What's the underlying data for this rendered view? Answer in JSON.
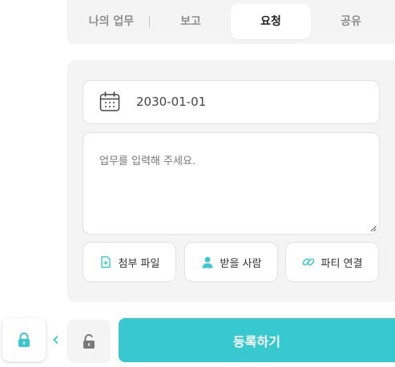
{
  "tabs": [
    {
      "label": "나의 업무",
      "active": false
    },
    {
      "label": "보고",
      "active": false
    },
    {
      "label": "요청",
      "active": true
    },
    {
      "label": "공유",
      "active": false
    }
  ],
  "form": {
    "date": "2030-01-01",
    "task_placeholder": "업무를 입력해 주세요.",
    "attach_label": "첨부 파일",
    "recipient_label": "받을 사람",
    "party_link_label": "파티 연결",
    "submit_label": "등록하기"
  },
  "icons": {
    "calendar": "calendar-icon",
    "attach": "file-plus-icon",
    "recipient": "person-icon",
    "party_link": "link-icon",
    "lock": "lock-icon",
    "unlock": "unlock-icon",
    "chevron": "chevron-left-icon"
  },
  "colors": {
    "accent": "#38c9d0",
    "panel_bg": "#f4f4f5",
    "muted_icon": "#7a7a7a"
  }
}
